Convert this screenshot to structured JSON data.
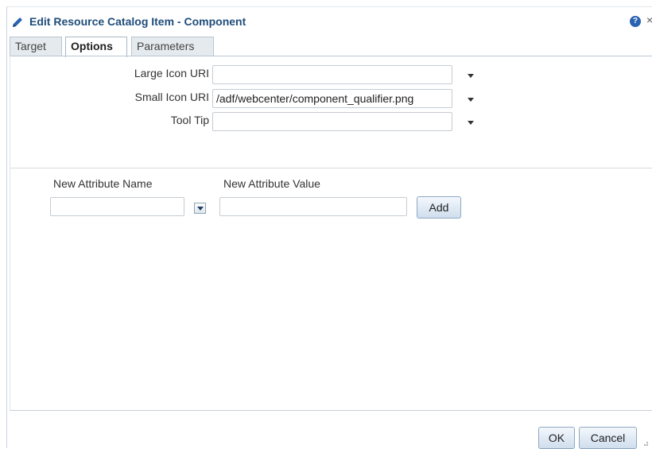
{
  "dialog": {
    "title": "Edit Resource Catalog Item - Component",
    "help_icon_glyph": "?",
    "close_icon_glyph": "×"
  },
  "tabs": [
    {
      "label": "Target",
      "active": false
    },
    {
      "label": "Options",
      "active": true
    },
    {
      "label": "Parameters",
      "active": false
    }
  ],
  "options": {
    "large_icon": {
      "label": "Large Icon URI",
      "value": ""
    },
    "small_icon": {
      "label": "Small Icon URI",
      "value": "/adf/webcenter/component_qualifier.png"
    },
    "tool_tip": {
      "label": "Tool Tip",
      "value": ""
    }
  },
  "attributes": {
    "name_header": "New Attribute Name",
    "value_header": "New Attribute Value",
    "name_value": "",
    "value_value": "",
    "add_label": "Add"
  },
  "footer": {
    "ok_label": "OK",
    "cancel_label": "Cancel"
  },
  "colors": {
    "title": "#1f4d7a",
    "accent": "#2a64b0",
    "button_border": "#8fa8c3"
  }
}
